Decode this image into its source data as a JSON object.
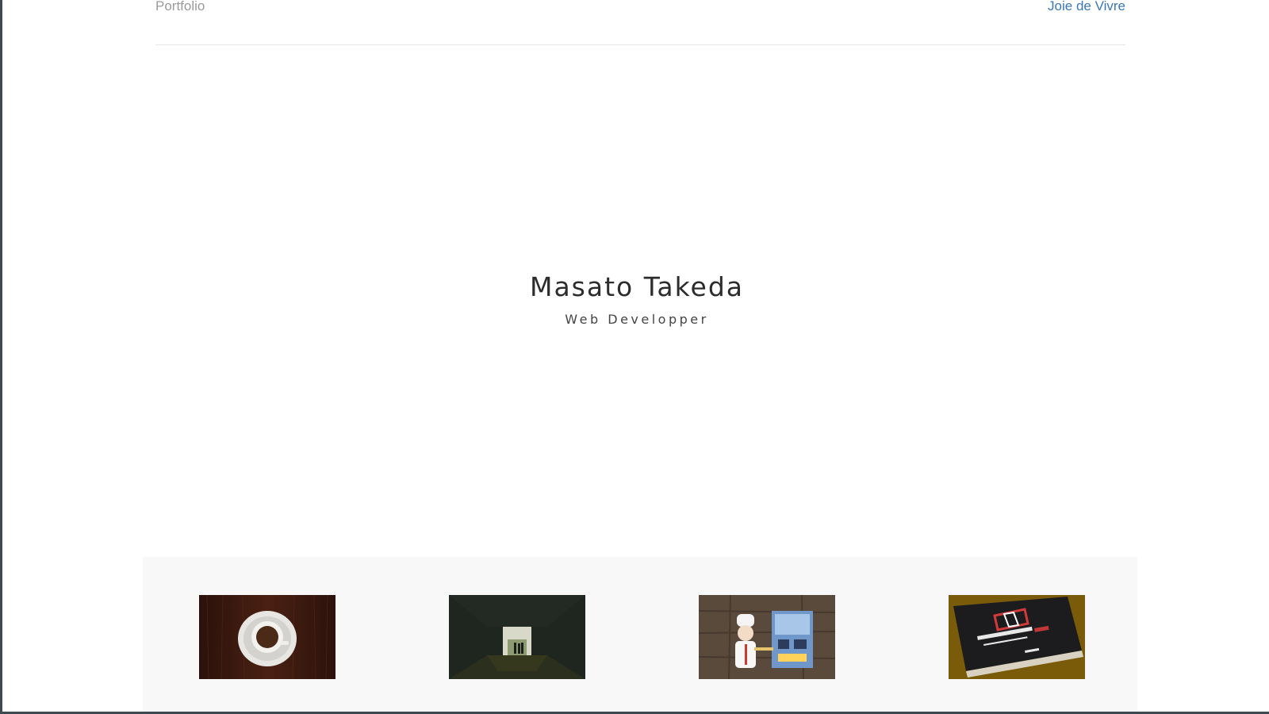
{
  "navbar": {
    "brand": "Portfolio",
    "link": "Joie de Vivre"
  },
  "hero": {
    "name": "Masato Takeda",
    "role": "Web Developper"
  },
  "gallery": {
    "items": [
      {
        "name": "coffee-cup-thumbnail"
      },
      {
        "name": "tunnel-thumbnail"
      },
      {
        "name": "toy-chef-thumbnail"
      },
      {
        "name": "angular-book-thumbnail"
      }
    ]
  },
  "colors": {
    "brand_text": "#9a9a9a",
    "link_text": "#3b78b6",
    "gallery_background": "#f8f8f8"
  }
}
